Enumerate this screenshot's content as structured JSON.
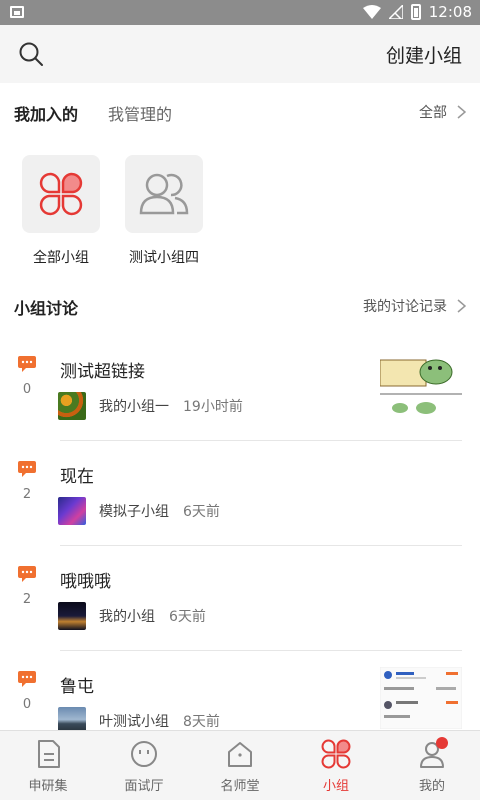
{
  "status_bar": {
    "time": "12:08"
  },
  "header": {
    "create_group_label": "创建小组"
  },
  "tabs": {
    "joined_label": "我加入的",
    "managed_label": "我管理的",
    "all_label": "全部"
  },
  "groups": [
    {
      "label": "全部小组",
      "icon": "clover-icon"
    },
    {
      "label": "测试小组四",
      "icon": "people-icon"
    }
  ],
  "discussion_section": {
    "title": "小组讨论",
    "record_label": "我的讨论记录"
  },
  "discussions": [
    {
      "title": "测试超链接",
      "count": "0",
      "group": "我的小组一",
      "time": "19小时前"
    },
    {
      "title": "现在",
      "count": "2",
      "group": "模拟子小组",
      "time": "6天前"
    },
    {
      "title": "哦哦哦",
      "count": "2",
      "group": "我的小组",
      "time": "6天前"
    },
    {
      "title": "鲁屯",
      "count": "0",
      "group": "叶测试小组",
      "time": "8天前"
    }
  ],
  "bottom_nav": [
    {
      "label": "申研集",
      "icon": "document-icon"
    },
    {
      "label": "面试厅",
      "icon": "face-icon"
    },
    {
      "label": "名师堂",
      "icon": "home-icon"
    },
    {
      "label": "小组",
      "icon": "clover-icon"
    },
    {
      "label": "我的",
      "icon": "user-icon"
    }
  ],
  "colors": {
    "accent": "#e53935",
    "bubble": "#f07030"
  }
}
